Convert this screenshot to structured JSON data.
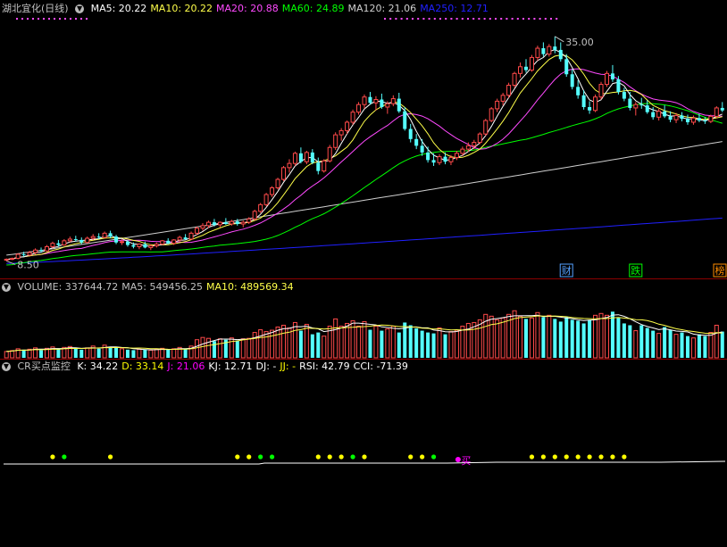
{
  "app": {
    "title": "湖北宜化(日线)"
  },
  "colors": {
    "up": "#ff4a4a",
    "down": "#54ffff",
    "ma5": "#ffffff",
    "ma10": "#ffff4a",
    "ma20": "#ff4aff",
    "ma60": "#00ff00",
    "ma120": "#cfcfcf",
    "ma250": "#2020ff",
    "kdj_k": "#ffffff",
    "kdj_d": "#ffff00",
    "kdj_j": "#ff00ff",
    "rsi": "#ffffff",
    "cci": "#ffffff",
    "label": "#c0c0c0"
  },
  "main_legend": [
    {
      "key": "ma5",
      "text": "MA5: 20.22"
    },
    {
      "key": "ma10",
      "text": "MA10: 20.22"
    },
    {
      "key": "ma20",
      "text": "MA20: 20.88"
    },
    {
      "key": "ma60",
      "text": "MA60: 24.89"
    },
    {
      "key": "ma120",
      "text": "MA120: 21.06"
    },
    {
      "key": "ma250",
      "text": "MA250: 12.71"
    }
  ],
  "volume_legend": [
    {
      "key": "label",
      "text": "VOLUME: 337644.72"
    },
    {
      "key": "label",
      "text": "MA5: 549456.25"
    },
    {
      "key": "ma10",
      "text": "MA10: 489569.34"
    }
  ],
  "indicator_legend": {
    "name": "CR买点监控",
    "items": [
      {
        "key": "kdj_k",
        "text": "K: 34.22"
      },
      {
        "key": "kdj_d",
        "text": "D: 33.14"
      },
      {
        "key": "kdj_j",
        "text": "J: 21.06"
      },
      {
        "key": "rsi",
        "text": "KJ: 12.71"
      },
      {
        "key": "rsi",
        "text": "DJ: -"
      },
      {
        "key": "kdj_d",
        "text": "JJ: -"
      },
      {
        "key": "rsi",
        "text": "RSI: 42.79"
      },
      {
        "key": "cci",
        "text": "CCI: -71.39"
      }
    ]
  },
  "chart_data": {
    "type": "candlestick",
    "price_range": [
      7.5,
      37.0
    ],
    "annotations": {
      "high": "35.00",
      "low": "8.50"
    },
    "badges": [
      {
        "text": "财",
        "color": "#54a0ff",
        "index": 97
      },
      {
        "text": "跌",
        "color": "#00ff00",
        "index": 109
      },
      {
        "text": "榜",
        "color": "#ff8c00",
        "index": 124
      }
    ],
    "buy_marker": {
      "text": "买",
      "index": 79
    },
    "candles": [
      [
        8.4,
        8.6,
        8.3,
        8.5
      ],
      [
        8.5,
        8.7,
        8.4,
        8.6
      ],
      [
        8.6,
        9.2,
        8.5,
        9.1
      ],
      [
        9.1,
        9.4,
        8.8,
        9.0
      ],
      [
        9.0,
        9.5,
        8.9,
        9.3
      ],
      [
        9.3,
        9.8,
        9.1,
        9.6
      ],
      [
        9.6,
        9.9,
        9.3,
        9.5
      ],
      [
        9.5,
        10.2,
        9.4,
        10.0
      ],
      [
        10.0,
        10.6,
        9.8,
        10.4
      ],
      [
        10.4,
        10.8,
        10.0,
        10.2
      ],
      [
        10.2,
        10.9,
        10.1,
        10.7
      ],
      [
        10.7,
        11.2,
        10.5,
        10.9
      ],
      [
        10.9,
        11.3,
        10.6,
        10.8
      ],
      [
        10.8,
        11.1,
        10.3,
        10.5
      ],
      [
        10.5,
        11.2,
        10.4,
        11.0
      ],
      [
        11.0,
        11.5,
        10.8,
        11.2
      ],
      [
        11.2,
        11.6,
        10.9,
        11.1
      ],
      [
        11.1,
        11.8,
        11.0,
        11.6
      ],
      [
        11.6,
        11.9,
        11.0,
        11.2
      ],
      [
        11.2,
        11.4,
        10.3,
        10.5
      ],
      [
        10.5,
        10.9,
        10.2,
        10.6
      ],
      [
        10.6,
        10.8,
        10.0,
        10.2
      ],
      [
        10.2,
        10.5,
        9.8,
        10.0
      ],
      [
        10.0,
        10.4,
        9.7,
        10.3
      ],
      [
        10.3,
        10.6,
        9.8,
        9.9
      ],
      [
        9.9,
        10.3,
        9.6,
        10.1
      ],
      [
        10.1,
        10.5,
        9.9,
        10.3
      ],
      [
        10.3,
        10.8,
        10.2,
        10.7
      ],
      [
        10.7,
        11.0,
        10.3,
        10.4
      ],
      [
        10.4,
        10.9,
        10.2,
        10.8
      ],
      [
        10.8,
        11.3,
        10.6,
        11.1
      ],
      [
        11.1,
        11.5,
        10.8,
        10.9
      ],
      [
        10.9,
        11.8,
        10.8,
        11.6
      ],
      [
        11.6,
        12.4,
        11.4,
        12.2
      ],
      [
        12.2,
        12.8,
        11.9,
        12.5
      ],
      [
        12.5,
        13.1,
        12.2,
        12.9
      ],
      [
        12.9,
        13.3,
        12.4,
        12.6
      ],
      [
        12.6,
        13.0,
        12.3,
        12.9
      ],
      [
        12.9,
        13.4,
        12.6,
        12.7
      ],
      [
        12.7,
        13.2,
        12.5,
        13.0
      ],
      [
        13.0,
        13.3,
        12.5,
        12.7
      ],
      [
        12.7,
        13.1,
        12.3,
        12.9
      ],
      [
        12.9,
        13.5,
        12.7,
        13.3
      ],
      [
        13.3,
        14.4,
        13.1,
        14.2
      ],
      [
        14.2,
        15.2,
        14.0,
        15.0
      ],
      [
        15.0,
        16.4,
        14.8,
        16.2
      ],
      [
        16.2,
        17.2,
        15.9,
        17.0
      ],
      [
        17.0,
        18.2,
        16.8,
        18.0
      ],
      [
        18.0,
        19.6,
        17.8,
        19.4
      ],
      [
        19.4,
        20.4,
        18.8,
        19.9
      ],
      [
        19.9,
        21.3,
        19.6,
        21.1
      ],
      [
        21.1,
        21.8,
        19.9,
        20.1
      ],
      [
        20.1,
        21.4,
        19.8,
        21.2
      ],
      [
        21.2,
        21.6,
        19.8,
        20.0
      ],
      [
        20.0,
        20.6,
        18.6,
        19.0
      ],
      [
        19.0,
        20.4,
        18.8,
        20.2
      ],
      [
        20.2,
        22.1,
        20.0,
        21.8
      ],
      [
        21.8,
        23.6,
        21.5,
        23.3
      ],
      [
        23.3,
        24.1,
        22.6,
        23.8
      ],
      [
        23.8,
        25.0,
        23.4,
        24.8
      ],
      [
        24.8,
        26.3,
        24.5,
        26.0
      ],
      [
        26.0,
        27.2,
        25.7,
        26.9
      ],
      [
        26.9,
        28.1,
        26.4,
        27.8
      ],
      [
        27.8,
        28.4,
        26.9,
        27.1
      ],
      [
        27.1,
        27.9,
        26.2,
        27.5
      ],
      [
        27.5,
        28.2,
        26.4,
        26.6
      ],
      [
        26.6,
        27.3,
        25.8,
        27.0
      ],
      [
        27.0,
        28.0,
        26.7,
        27.6
      ],
      [
        27.6,
        28.3,
        25.9,
        26.1
      ],
      [
        26.1,
        26.6,
        23.8,
        24.0
      ],
      [
        24.0,
        24.6,
        22.4,
        22.8
      ],
      [
        22.8,
        23.4,
        21.6,
        22.0
      ],
      [
        22.0,
        22.8,
        20.8,
        21.2
      ],
      [
        21.2,
        21.9,
        20.0,
        20.3
      ],
      [
        20.3,
        21.1,
        19.6,
        20.0
      ],
      [
        20.0,
        21.0,
        19.7,
        20.7
      ],
      [
        20.7,
        21.2,
        19.8,
        20.1
      ],
      [
        20.1,
        20.9,
        19.7,
        20.6
      ],
      [
        20.6,
        21.4,
        20.3,
        21.1
      ],
      [
        21.1,
        21.9,
        20.8,
        21.6
      ],
      [
        21.6,
        22.4,
        21.3,
        22.0
      ],
      [
        22.0,
        22.7,
        21.6,
        22.4
      ],
      [
        22.4,
        23.6,
        22.2,
        23.4
      ],
      [
        23.4,
        25.2,
        23.2,
        25.0
      ],
      [
        25.0,
        26.6,
        24.8,
        26.4
      ],
      [
        26.4,
        27.6,
        26.0,
        27.3
      ],
      [
        27.3,
        28.3,
        26.8,
        28.0
      ],
      [
        28.0,
        29.5,
        27.7,
        29.2
      ],
      [
        29.2,
        30.8,
        28.9,
        30.6
      ],
      [
        30.6,
        31.9,
        30.1,
        31.4
      ],
      [
        31.4,
        32.3,
        30.7,
        31.0
      ],
      [
        31.0,
        32.8,
        30.8,
        32.5
      ],
      [
        32.5,
        33.9,
        32.1,
        33.6
      ],
      [
        33.6,
        34.3,
        32.6,
        32.9
      ],
      [
        32.9,
        34.1,
        32.6,
        33.8
      ],
      [
        33.8,
        35.0,
        33.0,
        33.4
      ],
      [
        33.4,
        34.3,
        32.0,
        32.3
      ],
      [
        32.3,
        32.9,
        30.2,
        30.5
      ],
      [
        30.5,
        31.1,
        28.7,
        29.0
      ],
      [
        29.0,
        29.8,
        27.6,
        28.0
      ],
      [
        28.0,
        28.6,
        26.3,
        26.6
      ],
      [
        26.6,
        27.3,
        25.8,
        26.2
      ],
      [
        26.2,
        28.1,
        26.0,
        27.8
      ],
      [
        27.8,
        29.6,
        27.5,
        29.3
      ],
      [
        29.3,
        30.9,
        29.0,
        30.6
      ],
      [
        30.6,
        31.6,
        29.6,
        29.9
      ],
      [
        29.9,
        30.3,
        28.1,
        28.4
      ],
      [
        28.4,
        28.9,
        27.3,
        27.6
      ],
      [
        27.6,
        28.4,
        26.2,
        26.5
      ],
      [
        26.5,
        27.2,
        25.6,
        26.9
      ],
      [
        26.9,
        27.7,
        26.4,
        26.8
      ],
      [
        26.8,
        27.4,
        25.8,
        26.0
      ],
      [
        26.0,
        26.6,
        25.1,
        25.4
      ],
      [
        25.4,
        26.4,
        25.0,
        26.1
      ],
      [
        26.1,
        26.8,
        25.3,
        25.5
      ],
      [
        25.5,
        26.1,
        24.8,
        25.1
      ],
      [
        25.1,
        25.9,
        24.7,
        25.6
      ],
      [
        25.6,
        26.0,
        24.9,
        25.2
      ],
      [
        25.2,
        25.7,
        24.5,
        24.8
      ],
      [
        24.8,
        25.6,
        24.5,
        25.3
      ],
      [
        25.3,
        25.8,
        24.8,
        25.0
      ],
      [
        25.0,
        25.4,
        24.6,
        24.9
      ],
      [
        24.9,
        25.7,
        24.7,
        25.5
      ],
      [
        25.5,
        26.7,
        25.3,
        26.5
      ],
      [
        26.5,
        27.2,
        26.0,
        26.2
      ]
    ],
    "volume_range": [
      0,
      1400000
    ],
    "volume": [
      140000,
      160000,
      200000,
      180000,
      190000,
      220000,
      170000,
      210000,
      240000,
      190000,
      230000,
      250000,
      200000,
      180000,
      220000,
      260000,
      200000,
      280000,
      240000,
      220000,
      200000,
      180000,
      170000,
      190000,
      180000,
      170000,
      190000,
      210000,
      180000,
      200000,
      230000,
      190000,
      260000,
      400000,
      450000,
      430000,
      370000,
      420000,
      400000,
      440000,
      380000,
      420000,
      430000,
      560000,
      620000,
      580000,
      610000,
      680000,
      720000,
      660000,
      780000,
      600000,
      740000,
      520000,
      560000,
      480000,
      700000,
      860000,
      700000,
      760000,
      820000,
      700000,
      800000,
      620000,
      700000,
      600000,
      640000,
      700000,
      560000,
      780000,
      720000,
      650000,
      600000,
      560000,
      540000,
      660000,
      520000,
      580000,
      610000,
      700000,
      760000,
      780000,
      840000,
      960000,
      920000,
      840000,
      880000,
      960000,
      1040000,
      920000,
      860000,
      880000,
      1000000,
      900000,
      940000,
      860000,
      800000,
      900000,
      840000,
      820000,
      760000,
      840000,
      940000,
      980000,
      940000,
      1020000,
      880000,
      760000,
      720000,
      600000,
      720000,
      660000,
      600000,
      540000,
      680000,
      620000,
      520000,
      560000,
      480000,
      440000,
      520000,
      480000,
      560000,
      720000,
      580000
    ],
    "signal_dots": [
      {
        "index": 8,
        "color": "#ffff00"
      },
      {
        "index": 10,
        "color": "#00ff00"
      },
      {
        "index": 18,
        "color": "#ffff00"
      },
      {
        "index": 40,
        "color": "#ffff00"
      },
      {
        "index": 42,
        "color": "#ffff00"
      },
      {
        "index": 44,
        "color": "#00ff00"
      },
      {
        "index": 46,
        "color": "#00ff00"
      },
      {
        "index": 54,
        "color": "#ffff00"
      },
      {
        "index": 56,
        "color": "#ffff00"
      },
      {
        "index": 58,
        "color": "#ffff00"
      },
      {
        "index": 60,
        "color": "#00ff00"
      },
      {
        "index": 62,
        "color": "#ffff00"
      },
      {
        "index": 70,
        "color": "#ffff00"
      },
      {
        "index": 72,
        "color": "#ffff00"
      },
      {
        "index": 74,
        "color": "#00ff00"
      },
      {
        "index": 91,
        "color": "#ffff00"
      },
      {
        "index": 93,
        "color": "#ffff00"
      },
      {
        "index": 95,
        "color": "#ffff00"
      },
      {
        "index": 97,
        "color": "#ffff00"
      },
      {
        "index": 99,
        "color": "#ffff00"
      },
      {
        "index": 101,
        "color": "#ffff00"
      },
      {
        "index": 103,
        "color": "#ffff00"
      },
      {
        "index": 105,
        "color": "#ffff00"
      },
      {
        "index": 107,
        "color": "#ffff00"
      }
    ]
  }
}
